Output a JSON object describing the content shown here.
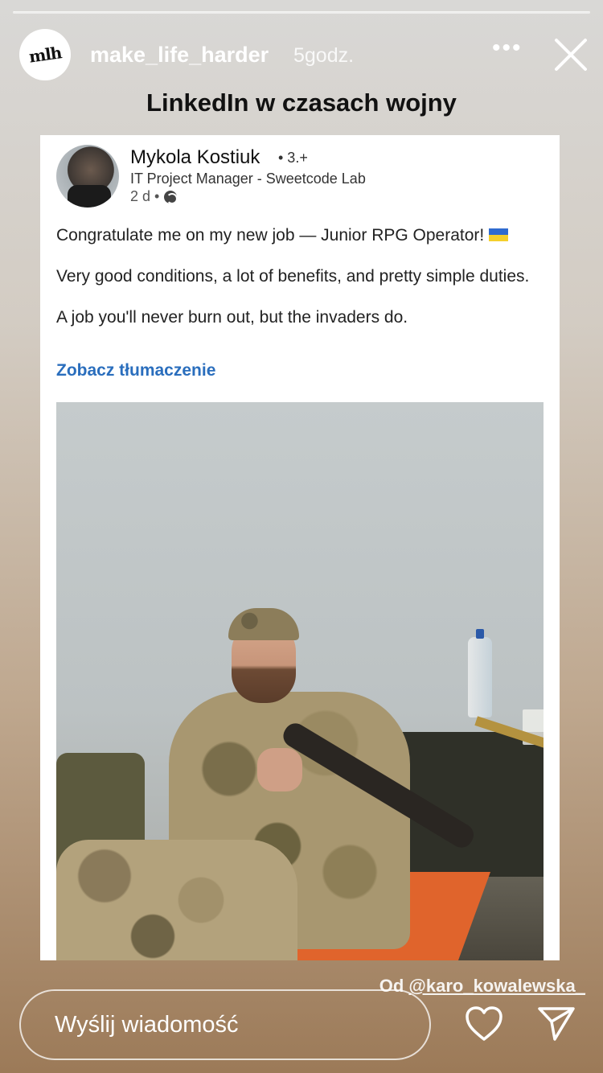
{
  "story": {
    "username": "make_life_harder",
    "time_ago": "5godz.",
    "avatar_logo": "mlh",
    "more_icon": "more-dots-icon",
    "close_icon": "close-icon",
    "progress_segments": 1
  },
  "title": "LinkedIn w czasach wojny",
  "post": {
    "author_name": "Mykola Kostiuk",
    "connection_degree": "• 3.+",
    "headline": "IT Project Manager - Sweetcode Lab",
    "posted": "2 d •",
    "paragraphs": [
      "Congratulate me on my new job — Junior RPG Operator!",
      "Very good conditions, a lot of benefits, and pretty simple duties.",
      "A job you'll never burn out, but the invaders do."
    ],
    "translate_link": "Zobacz tłumaczenie"
  },
  "attribution": {
    "prefix": "Od ",
    "handle": "@karo_kowalewska_"
  },
  "footer": {
    "message_placeholder": "Wyślij wiadomość",
    "like_icon": "heart-icon",
    "share_icon": "send-icon"
  },
  "colors": {
    "link": "#2a6ebd",
    "flag_blue": "#2f6bd0",
    "flag_yellow": "#f5cf2c"
  }
}
